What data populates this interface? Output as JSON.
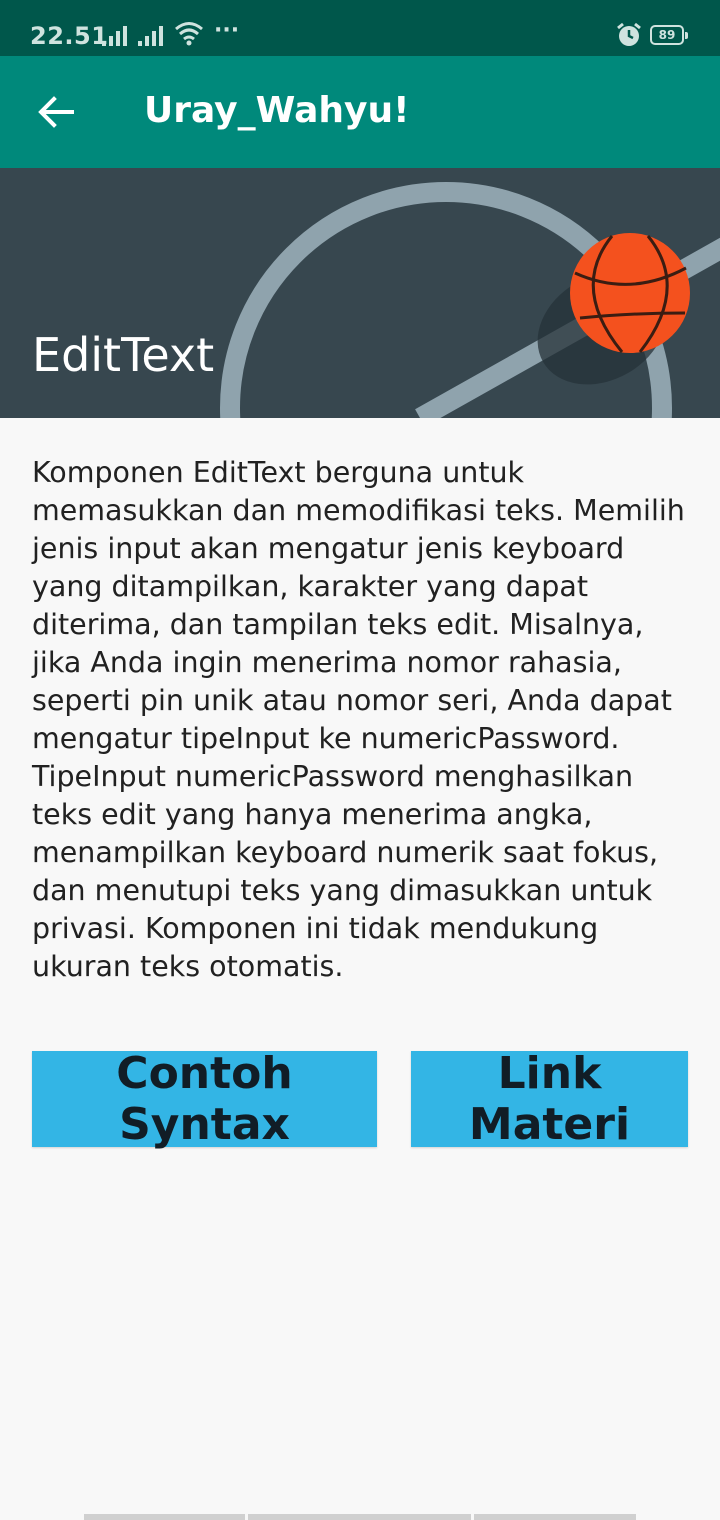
{
  "status_bar": {
    "time": "22.51",
    "more": "···",
    "battery": "89"
  },
  "app_bar": {
    "title": "Uray_Wahyu!",
    "back_icon": "arrow-left-icon"
  },
  "banner": {
    "title": "EditText",
    "illustration": "basketball-court-icon"
  },
  "content": {
    "description": "Komponen EditText berguna untuk memasukkan dan memodifikasi teks. Memilih jenis input akan mengatur jenis keyboard yang ditampilkan, karakter yang dapat diterima, dan tampilan teks edit. Misalnya, jika Anda ingin menerima nomor rahasia, seperti pin unik atau nomor seri, Anda dapat mengatur tipeInput ke numericPassword. TipeInput numericPassword menghasilkan teks edit yang hanya menerima angka, menampilkan keyboard numerik saat fokus, dan menutupi teks yang dimasukkan untuk privasi. Komponen ini tidak mendukung ukuran teks otomatis."
  },
  "buttons": {
    "syntax_label": "Contoh Syntax",
    "link_label": "Link Materi"
  },
  "colors": {
    "status_bar": "#00574b",
    "app_bar": "#00897b",
    "banner_bg": "#37474f",
    "button": "#33b5e5",
    "ball": "#f4511e"
  }
}
